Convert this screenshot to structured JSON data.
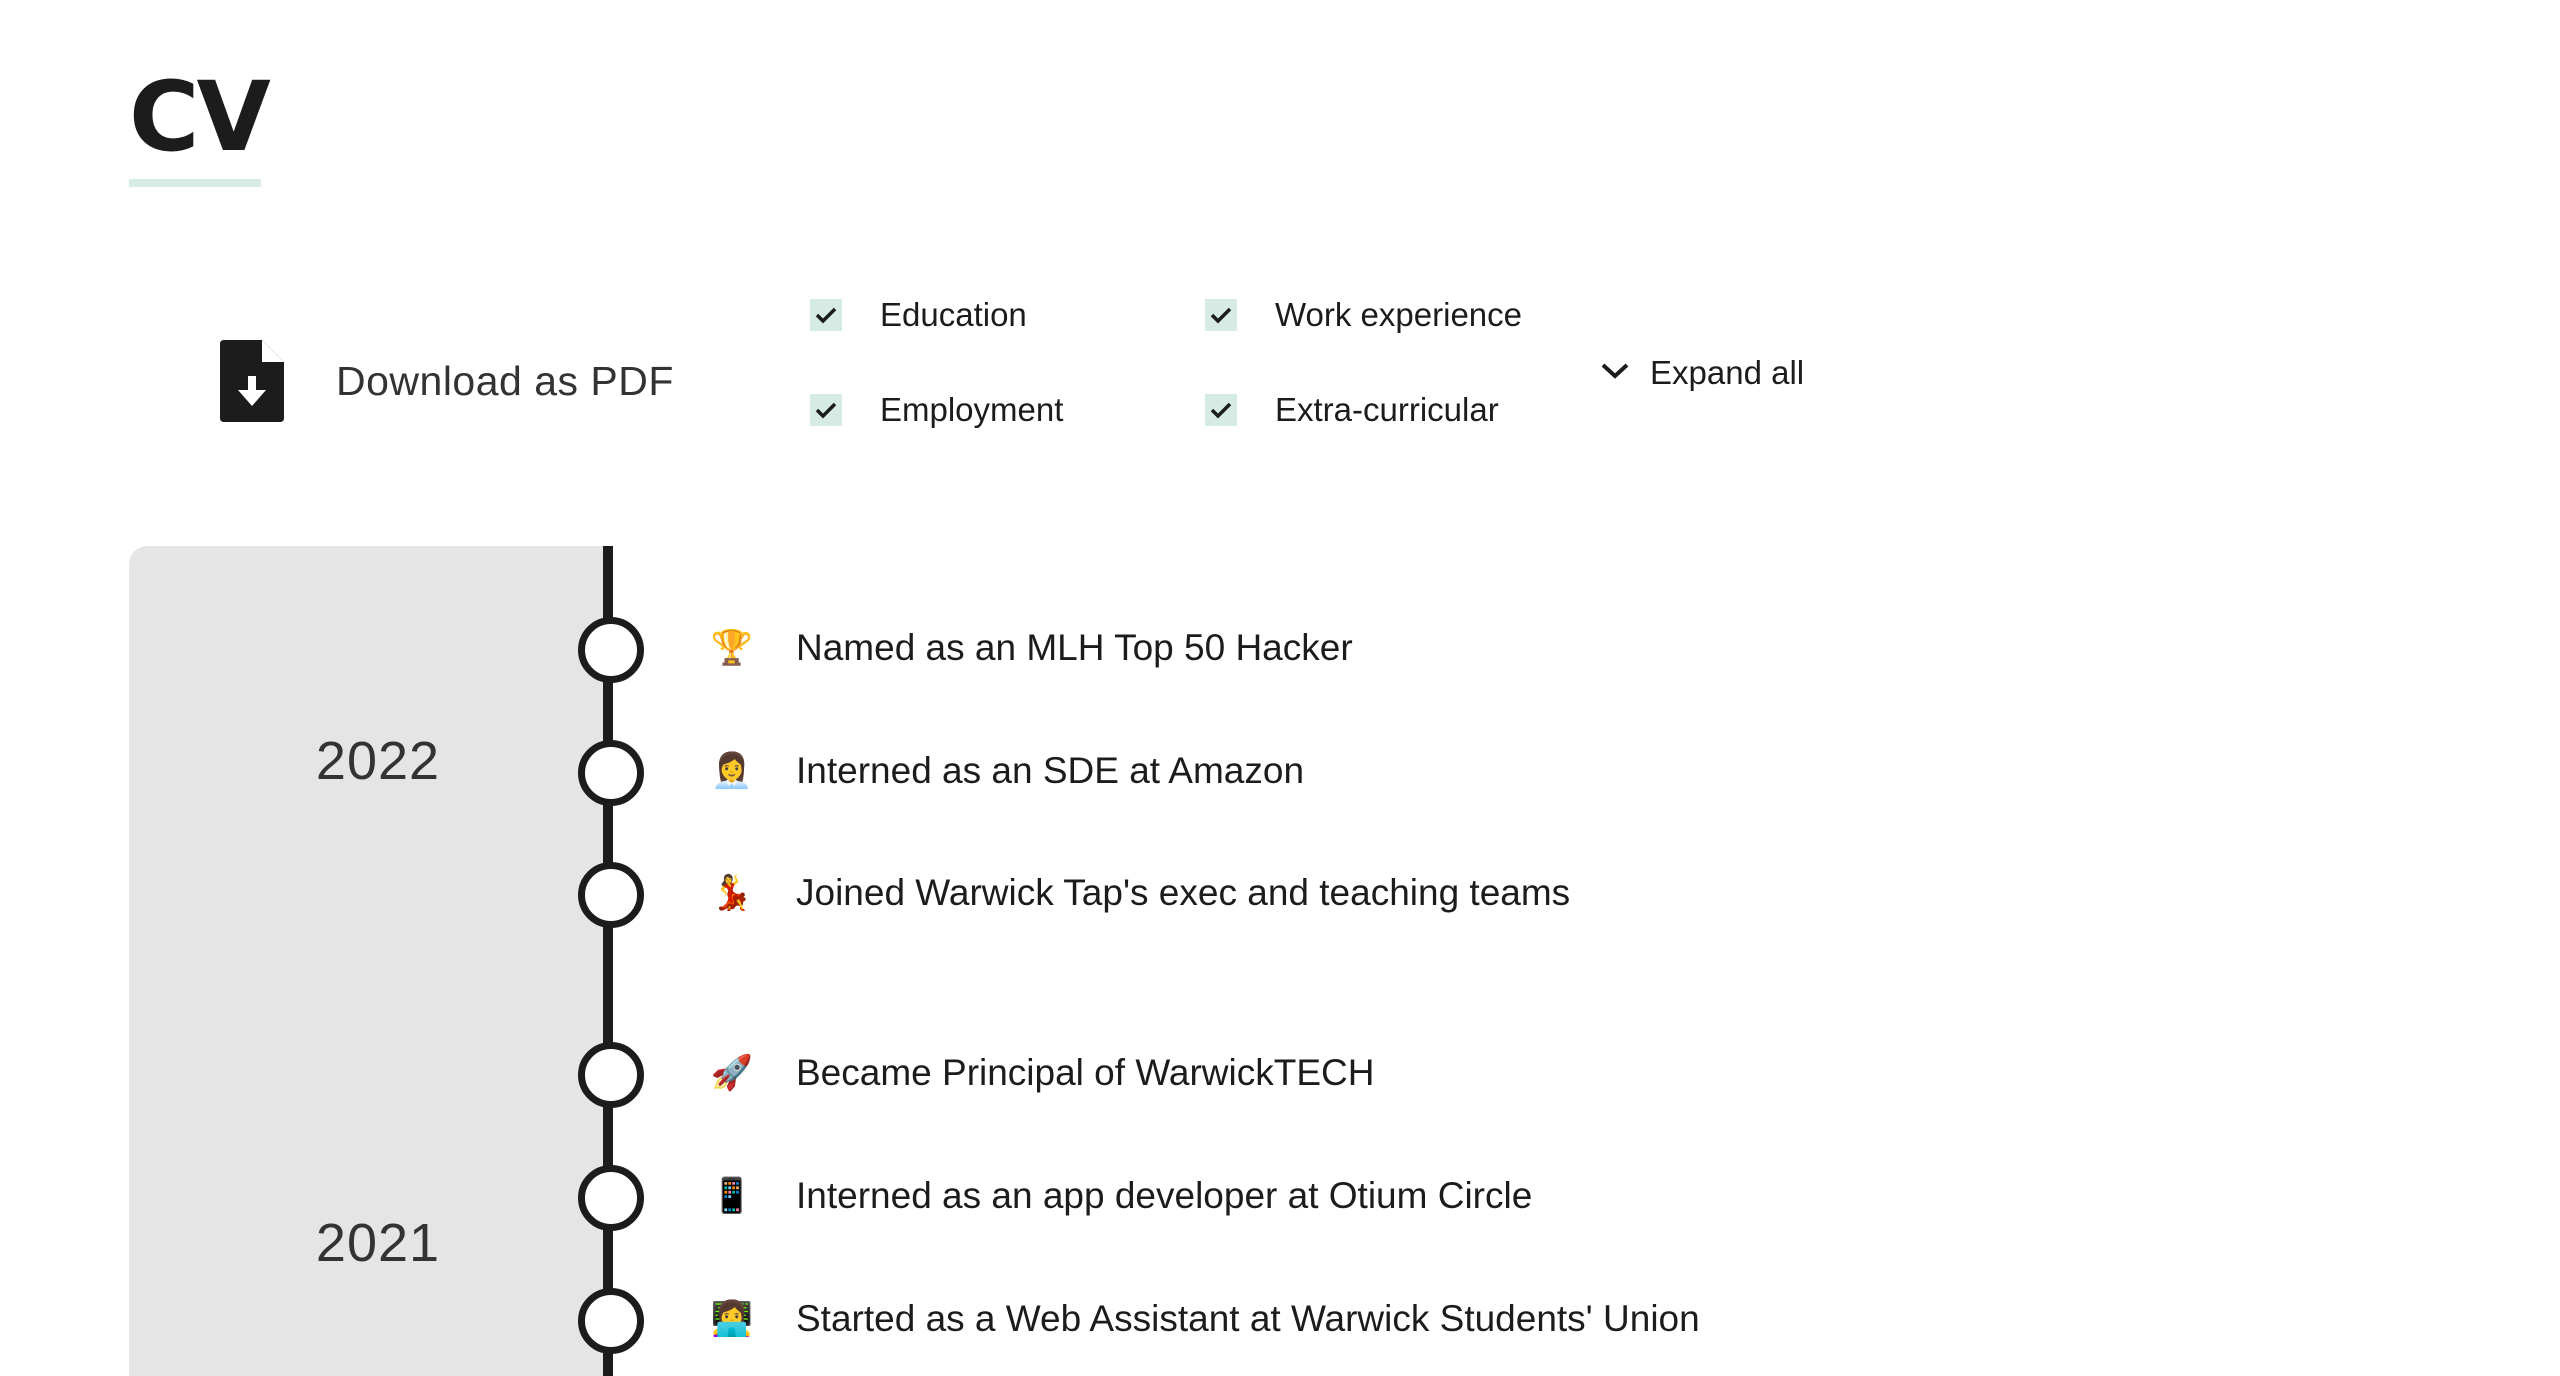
{
  "header": {
    "title": "CV"
  },
  "download": {
    "label": "Download as PDF",
    "icon": "file-download-icon"
  },
  "filters": [
    {
      "label": "Education",
      "checked": true
    },
    {
      "label": "Work experience",
      "checked": true
    },
    {
      "label": "Employment",
      "checked": true
    },
    {
      "label": "Extra-curricular",
      "checked": true
    }
  ],
  "expand": {
    "label": "Expand all",
    "icon": "chevron-down-icon"
  },
  "timeline": {
    "years": [
      "2022",
      "2021"
    ],
    "events": [
      {
        "emoji": "🏆",
        "text": "Named as an MLH Top 50 Hacker",
        "year": "2022"
      },
      {
        "emoji": "👩‍💼",
        "text": "Interned as an SDE at Amazon",
        "year": "2022"
      },
      {
        "emoji": "💃",
        "text": "Joined Warwick Tap's exec and teaching teams",
        "year": "2022"
      },
      {
        "emoji": "🚀",
        "text": "Became Principal of WarwickTECH",
        "year": "2021"
      },
      {
        "emoji": "📱",
        "text": "Interned as an app developer at Otium Circle",
        "year": "2021"
      },
      {
        "emoji": "👩‍💻",
        "text": "Started as a Web Assistant at Warwick Students' Union",
        "year": "2021"
      }
    ]
  },
  "colors": {
    "accent": "#d6ebe4",
    "text": "#1c1c1c",
    "panel": "#e5e5e5"
  }
}
